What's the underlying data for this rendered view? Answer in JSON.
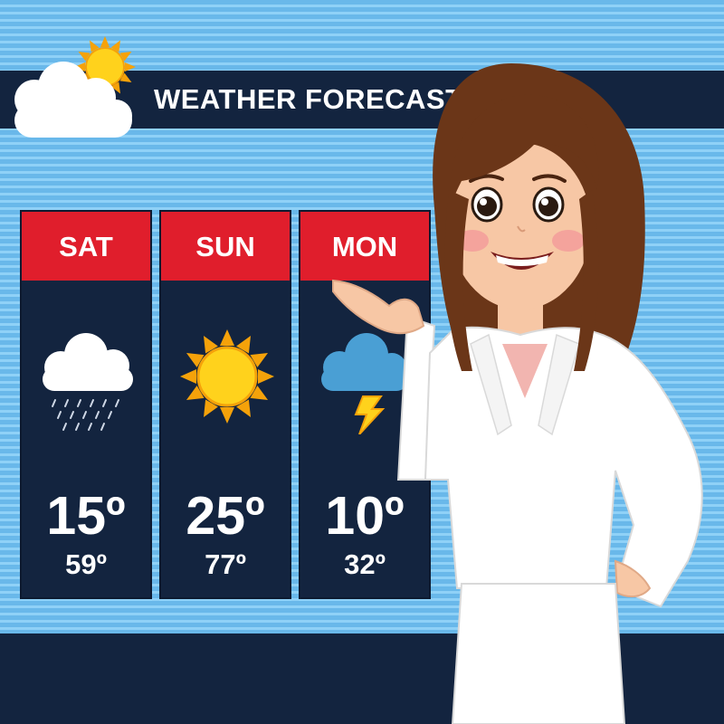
{
  "header": {
    "title": "WEATHER FORECAST",
    "icon": "sun-behind-cloud-icon"
  },
  "forecast": [
    {
      "day": "SAT",
      "high": "15º",
      "low": "59º",
      "icon": "rain-cloud-icon"
    },
    {
      "day": "SUN",
      "high": "25º",
      "low": "77º",
      "icon": "sun-icon"
    },
    {
      "day": "MON",
      "high": "10º",
      "low": "32º",
      "icon": "thunderstorm-icon"
    }
  ],
  "colors": {
    "background": "#6fc0ee",
    "panel": "#13243f",
    "accent": "#e01e2c",
    "text": "#ffffff"
  }
}
